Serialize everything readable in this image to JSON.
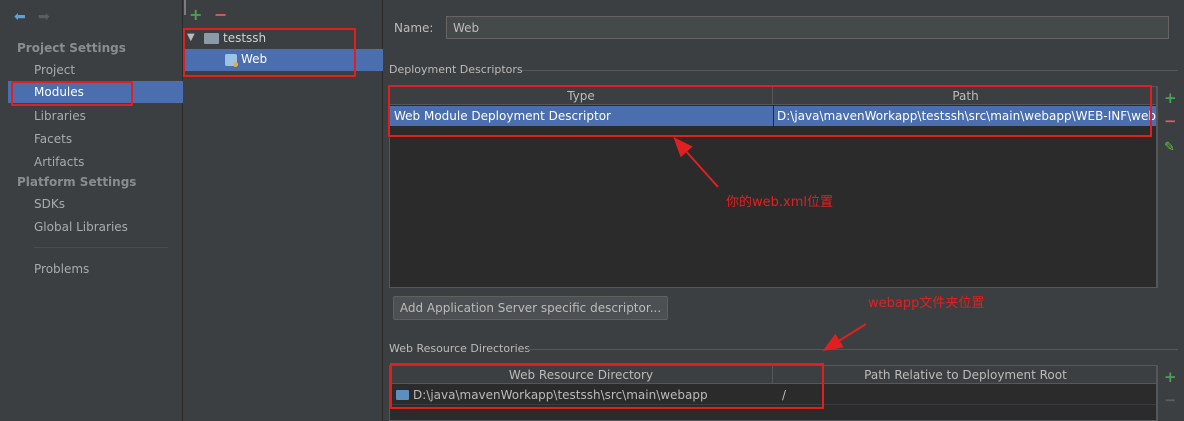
{
  "nav": {
    "project_settings_header": "Project Settings",
    "project_settings_items": [
      "Project",
      "Modules",
      "Libraries",
      "Facets",
      "Artifacts"
    ],
    "platform_settings_header": "Platform Settings",
    "platform_settings_items": [
      "SDKs",
      "Global Libraries"
    ],
    "problems": "Problems",
    "selected": "Modules"
  },
  "tree": {
    "root_label": "testssh",
    "child_label": "Web"
  },
  "name_field": {
    "label": "Name:",
    "value": "Web"
  },
  "deployment_descriptors": {
    "title": "Deployment Descriptors",
    "columns": [
      "Type",
      "Path"
    ],
    "rows": [
      {
        "type": "Web Module Deployment Descriptor",
        "path": "D:\\java\\mavenWorkapp\\testssh\\src\\main\\webapp\\WEB-INF\\web.xml"
      }
    ]
  },
  "add_server_button": "Add Application Server specific descriptor...",
  "web_resource_directories": {
    "title": "Web Resource Directories",
    "columns": [
      "Web Resource Directory",
      "Path Relative to Deployment Root"
    ],
    "rows": [
      {
        "directory": "D:\\java\\mavenWorkapp\\testssh\\src\\main\\webapp",
        "relative": "/"
      }
    ]
  },
  "annotations": {
    "webxml_note": "你的web.xml位置",
    "webapp_note": "webapp文件夹位置",
    "color": "#e02020"
  },
  "colors": {
    "background": "#3c3f41",
    "selection": "#4b6eaf",
    "table_background": "#2b2b2b"
  }
}
